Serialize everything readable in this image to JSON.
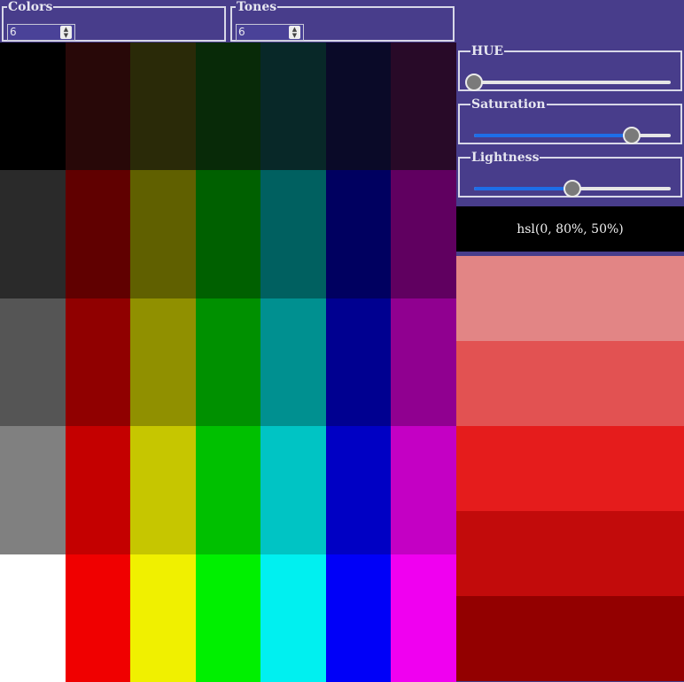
{
  "controls": {
    "colors": {
      "legend": "Colors",
      "value": "6"
    },
    "tones": {
      "legend": "Tones",
      "value": "6"
    }
  },
  "sliders": {
    "hue": {
      "legend": "HUE",
      "value": 0,
      "min": 0,
      "max": 360
    },
    "saturation": {
      "legend": "Saturation",
      "value": 80,
      "min": 0,
      "max": 100
    },
    "lightness": {
      "legend": "Lightness",
      "value": 50,
      "min": 0,
      "max": 100
    }
  },
  "readout": {
    "text": "hsl(0, 80%, 50%)"
  },
  "palette": [
    [
      "#000000",
      "#280808",
      "#2a2a08",
      "#082a08",
      "#082828",
      "#0a0a28",
      "#280a28"
    ],
    [
      "#2a2a2a",
      "#600000",
      "#606000",
      "#006000",
      "#006060",
      "#000060",
      "#600060"
    ],
    [
      "#555555",
      "#900000",
      "#909000",
      "#009000",
      "#009090",
      "#000090",
      "#900090"
    ],
    [
      "#808080",
      "#c40000",
      "#c6c600",
      "#00c000",
      "#00c4c4",
      "#0000c4",
      "#c400c4"
    ],
    [
      "#ffffff",
      "#f00000",
      "#f0f000",
      "#00f000",
      "#00f0f0",
      "#0000f8",
      "#f000f0"
    ]
  ],
  "tones": [
    "#e28585",
    "#e25252",
    "#e51c1c",
    "#c20b0b",
    "#930000"
  ]
}
